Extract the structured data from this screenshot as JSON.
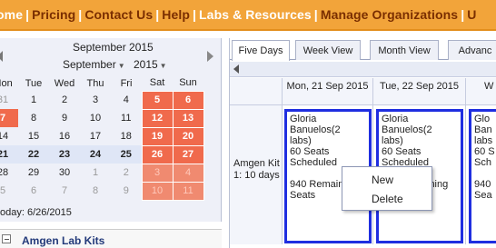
{
  "topnav": {
    "items": [
      {
        "label": "ome"
      },
      {
        "label": "Pricing"
      },
      {
        "label": "Contact Us"
      },
      {
        "label": "Help"
      },
      {
        "label": "Labs & Resources"
      },
      {
        "label": "Manage Organizations"
      },
      {
        "label": "U"
      }
    ],
    "separator": "|"
  },
  "mini_calendar": {
    "title": "September 2015",
    "month_select": "September",
    "year_select": "2015",
    "weekdays": [
      "Mon",
      "Tue",
      "Wed",
      "Thu",
      "Fri",
      "Sat",
      "Sun"
    ],
    "weeks": [
      [
        "31",
        "1",
        "2",
        "3",
        "4",
        "5",
        "6"
      ],
      [
        "7",
        "8",
        "9",
        "10",
        "11",
        "12",
        "13"
      ],
      [
        "14",
        "15",
        "16",
        "17",
        "18",
        "19",
        "20"
      ],
      [
        "21",
        "22",
        "23",
        "24",
        "25",
        "26",
        "27"
      ],
      [
        "28",
        "29",
        "30",
        "1",
        "2",
        "3",
        "4"
      ],
      [
        "5",
        "6",
        "7",
        "8",
        "9",
        "10",
        "11"
      ]
    ],
    "today_text": "oday: 6/26/2015"
  },
  "lab_kits": {
    "label": "Amgen Lab Kits"
  },
  "scheduler": {
    "tabs": [
      "Five Days",
      "Week View",
      "Month View",
      "Advanc"
    ],
    "active_tab": "Five Days",
    "columns": [
      "Mon, 21 Sep 2015",
      "Tue, 22 Sep 2015",
      "W"
    ],
    "row_label": "Amgen Kit 1: 10 days",
    "events": [
      {
        "lines": [
          "Gloria",
          "Banuelos(2",
          "labs)",
          "60 Seats",
          "Scheduled",
          "",
          "940 Remain",
          "Seats"
        ]
      },
      {
        "lines": [
          "Gloria",
          "Banuelos(2",
          "labs)",
          "60 Seats",
          "Scheduled",
          "",
          "",
          "ining"
        ]
      },
      {
        "lines": [
          "Glo",
          "Ban",
          "labs",
          "60 S",
          "Sch",
          "",
          "940",
          "Sea"
        ]
      }
    ]
  },
  "context_menu": {
    "items": [
      "New",
      "Delete"
    ]
  },
  "colors": {
    "nav_bg": "#f2a43a",
    "weekend": "#f06a4c",
    "event_border": "#1f2ee0"
  }
}
